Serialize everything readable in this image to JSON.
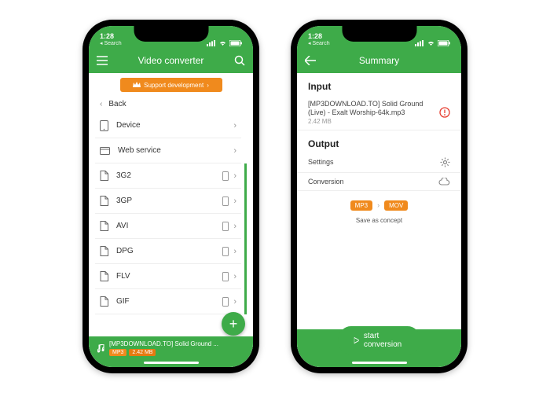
{
  "status": {
    "time": "1:28",
    "back_label": "◂ Search"
  },
  "left": {
    "title": "Video converter",
    "support": "Support development",
    "back": "Back",
    "items": [
      {
        "label": "Device",
        "icon": "device",
        "accent": false
      },
      {
        "label": "Web service",
        "icon": "web",
        "accent": false
      },
      {
        "label": "3G2",
        "icon": "file",
        "accent": true
      },
      {
        "label": "3GP",
        "icon": "file",
        "accent": true
      },
      {
        "label": "AVI",
        "icon": "file",
        "accent": true
      },
      {
        "label": "DPG",
        "icon": "file",
        "accent": true
      },
      {
        "label": "FLV",
        "icon": "file",
        "accent": true
      },
      {
        "label": "GIF",
        "icon": "file",
        "accent": true
      }
    ],
    "footer": {
      "filename": "[MP3DOWNLOAD.TO] Solid Ground ...",
      "format": "MP3",
      "size": "2.42 MB"
    }
  },
  "right": {
    "title": "Summary",
    "input_heading": "Input",
    "input_file": "[MP3DOWNLOAD.TO] Solid Ground (Live) - Exalt Worship-64k.mp3",
    "input_size": "2.42 MB",
    "output_heading": "Output",
    "settings_label": "Settings",
    "conversion_label": "Conversion",
    "from_fmt": "MP3",
    "to_fmt": "MOV",
    "save_concept": "Save as concept",
    "start": "start conversion"
  }
}
